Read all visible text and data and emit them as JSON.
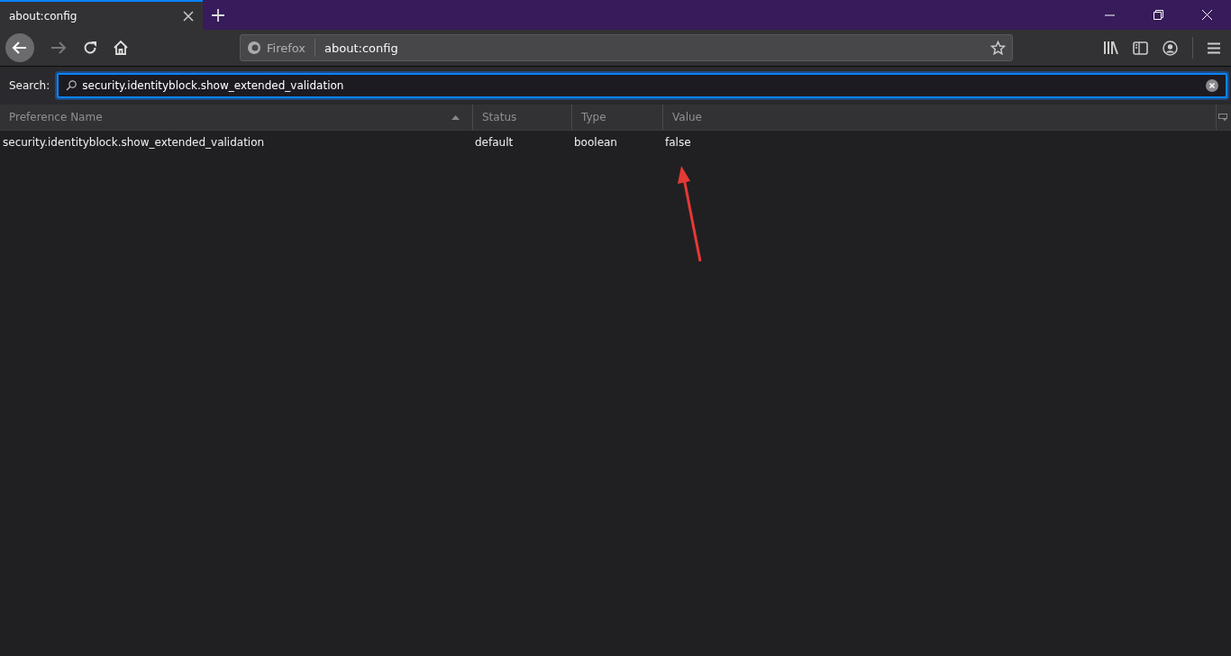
{
  "tabs": [
    {
      "label": "about:config",
      "selected": true
    }
  ],
  "url_bar": {
    "identity": "Firefox",
    "url": "about:config"
  },
  "search": {
    "label": "Search:",
    "value": "security.identityblock.show_extended_validation"
  },
  "table": {
    "columns": [
      {
        "label": "Preference Name",
        "sorted": true
      },
      {
        "label": "Status",
        "sorted": false
      },
      {
        "label": "Type",
        "sorted": false
      },
      {
        "label": "Value",
        "sorted": false
      }
    ],
    "rows": [
      {
        "cells": [
          "security.identityblock.show_extended_validation",
          "default",
          "boolean",
          "false"
        ]
      }
    ]
  }
}
